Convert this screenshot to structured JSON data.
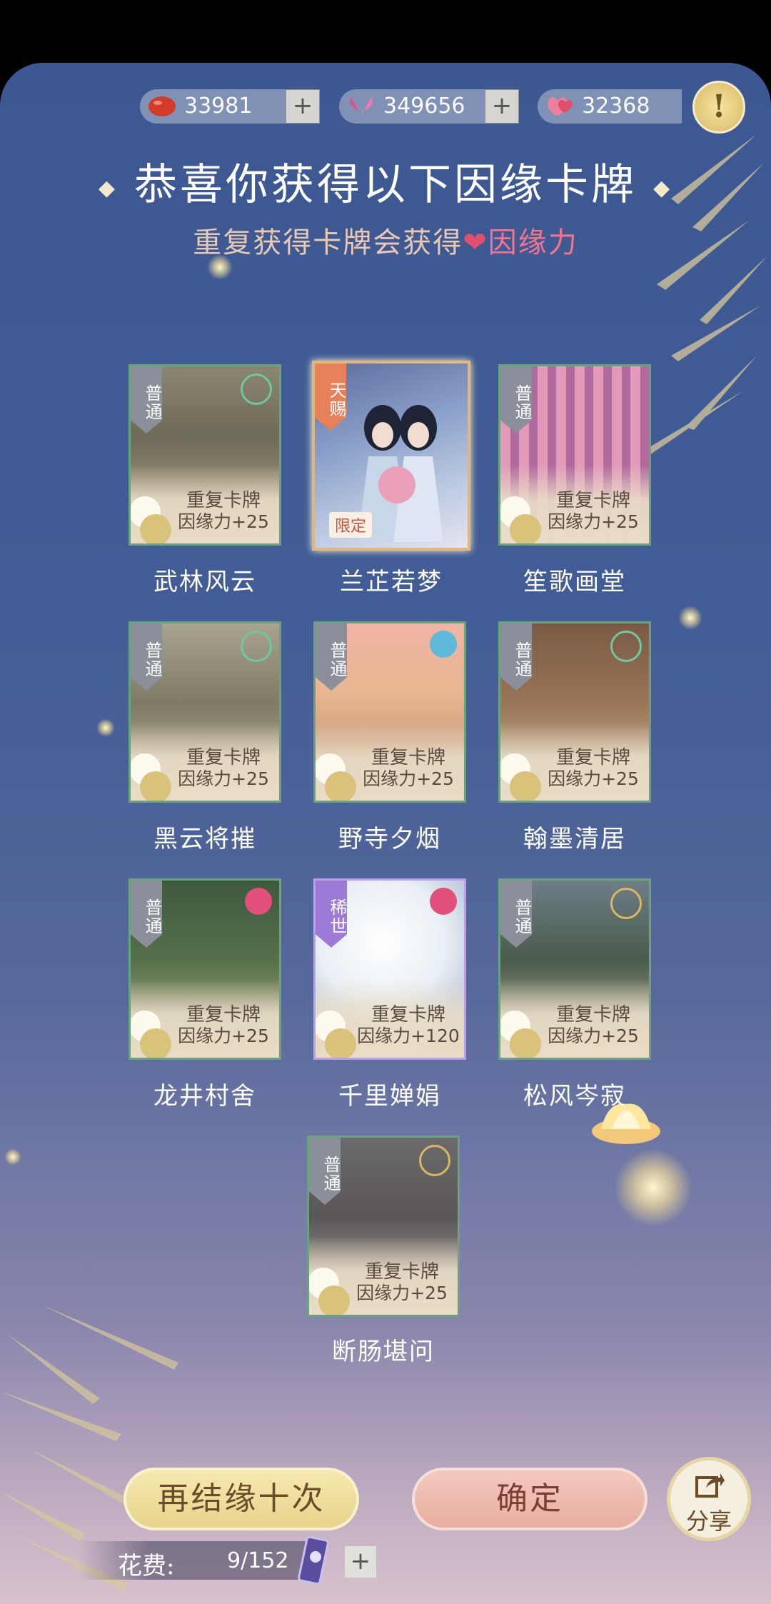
{
  "currencies": [
    {
      "name": "bean",
      "icon": "red-bean-icon",
      "amount": "33981",
      "plus": "+"
    },
    {
      "name": "butterfly",
      "icon": "butterfly-icon",
      "amount": "349656",
      "plus": "+"
    },
    {
      "name": "fate",
      "icon": "hearts-icon",
      "amount": "32368"
    }
  ],
  "alert_symbol": "!",
  "title": "恭喜你获得以下因缘卡牌",
  "subtitle": {
    "prefix": "重复获得卡牌会获得",
    "highlight": "因缘力"
  },
  "cards": [
    {
      "name": "武林风云",
      "rank": "普通",
      "dup": "重复卡牌",
      "bonus": "因缘力+25"
    },
    {
      "name": "兰芷若梦",
      "rank": "天赐",
      "tag": "限定"
    },
    {
      "name": "笙歌画堂",
      "rank": "普通",
      "dup": "重复卡牌",
      "bonus": "因缘力+25"
    },
    {
      "name": "黑云将摧",
      "rank": "普通",
      "dup": "重复卡牌",
      "bonus": "因缘力+25"
    },
    {
      "name": "野寺夕烟",
      "rank": "普通",
      "dup": "重复卡牌",
      "bonus": "因缘力+25"
    },
    {
      "name": "翰墨清居",
      "rank": "普通",
      "dup": "重复卡牌",
      "bonus": "因缘力+25"
    },
    {
      "name": "龙井村舍",
      "rank": "普通",
      "dup": "重复卡牌",
      "bonus": "因缘力+25"
    },
    {
      "name": "千里婵娟",
      "rank": "稀世",
      "dup": "重复卡牌",
      "bonus": "因缘力+120"
    },
    {
      "name": "松风岑寂",
      "rank": "普通",
      "dup": "重复卡牌",
      "bonus": "因缘力+25"
    },
    {
      "name": "断肠堪问",
      "rank": "普通",
      "dup": "重复卡牌",
      "bonus": "因缘力+25"
    }
  ],
  "buttons": {
    "retry": "再结缘十次",
    "confirm": "确定",
    "share": "分享"
  },
  "cost": {
    "label": "花费:",
    "value": "9/152",
    "plus": "+"
  },
  "colors": {
    "accent_pink": "#f2758e",
    "card_border_common": "#6aa17f",
    "rank_common": "#8a8f9a",
    "rank_tian": "#e8805a",
    "rank_rare": "#9c7ad6"
  }
}
